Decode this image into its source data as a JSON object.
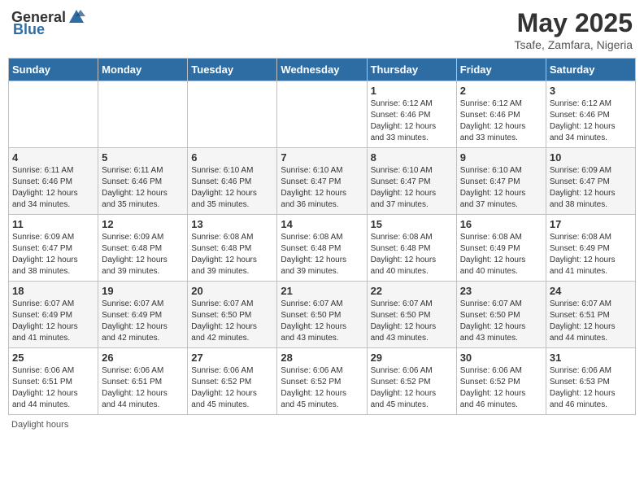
{
  "header": {
    "logo_general": "General",
    "logo_blue": "Blue",
    "month": "May 2025",
    "location": "Tsafe, Zamfara, Nigeria"
  },
  "days_of_week": [
    "Sunday",
    "Monday",
    "Tuesday",
    "Wednesday",
    "Thursday",
    "Friday",
    "Saturday"
  ],
  "footer": {
    "daylight_hours": "Daylight hours"
  },
  "weeks": [
    [
      {
        "day": "",
        "info": ""
      },
      {
        "day": "",
        "info": ""
      },
      {
        "day": "",
        "info": ""
      },
      {
        "day": "",
        "info": ""
      },
      {
        "day": "1",
        "info": "Sunrise: 6:12 AM\nSunset: 6:46 PM\nDaylight: 12 hours\nand 33 minutes."
      },
      {
        "day": "2",
        "info": "Sunrise: 6:12 AM\nSunset: 6:46 PM\nDaylight: 12 hours\nand 33 minutes."
      },
      {
        "day": "3",
        "info": "Sunrise: 6:12 AM\nSunset: 6:46 PM\nDaylight: 12 hours\nand 34 minutes."
      }
    ],
    [
      {
        "day": "4",
        "info": "Sunrise: 6:11 AM\nSunset: 6:46 PM\nDaylight: 12 hours\nand 34 minutes."
      },
      {
        "day": "5",
        "info": "Sunrise: 6:11 AM\nSunset: 6:46 PM\nDaylight: 12 hours\nand 35 minutes."
      },
      {
        "day": "6",
        "info": "Sunrise: 6:10 AM\nSunset: 6:46 PM\nDaylight: 12 hours\nand 35 minutes."
      },
      {
        "day": "7",
        "info": "Sunrise: 6:10 AM\nSunset: 6:47 PM\nDaylight: 12 hours\nand 36 minutes."
      },
      {
        "day": "8",
        "info": "Sunrise: 6:10 AM\nSunset: 6:47 PM\nDaylight: 12 hours\nand 37 minutes."
      },
      {
        "day": "9",
        "info": "Sunrise: 6:10 AM\nSunset: 6:47 PM\nDaylight: 12 hours\nand 37 minutes."
      },
      {
        "day": "10",
        "info": "Sunrise: 6:09 AM\nSunset: 6:47 PM\nDaylight: 12 hours\nand 38 minutes."
      }
    ],
    [
      {
        "day": "11",
        "info": "Sunrise: 6:09 AM\nSunset: 6:47 PM\nDaylight: 12 hours\nand 38 minutes."
      },
      {
        "day": "12",
        "info": "Sunrise: 6:09 AM\nSunset: 6:48 PM\nDaylight: 12 hours\nand 39 minutes."
      },
      {
        "day": "13",
        "info": "Sunrise: 6:08 AM\nSunset: 6:48 PM\nDaylight: 12 hours\nand 39 minutes."
      },
      {
        "day": "14",
        "info": "Sunrise: 6:08 AM\nSunset: 6:48 PM\nDaylight: 12 hours\nand 39 minutes."
      },
      {
        "day": "15",
        "info": "Sunrise: 6:08 AM\nSunset: 6:48 PM\nDaylight: 12 hours\nand 40 minutes."
      },
      {
        "day": "16",
        "info": "Sunrise: 6:08 AM\nSunset: 6:49 PM\nDaylight: 12 hours\nand 40 minutes."
      },
      {
        "day": "17",
        "info": "Sunrise: 6:08 AM\nSunset: 6:49 PM\nDaylight: 12 hours\nand 41 minutes."
      }
    ],
    [
      {
        "day": "18",
        "info": "Sunrise: 6:07 AM\nSunset: 6:49 PM\nDaylight: 12 hours\nand 41 minutes."
      },
      {
        "day": "19",
        "info": "Sunrise: 6:07 AM\nSunset: 6:49 PM\nDaylight: 12 hours\nand 42 minutes."
      },
      {
        "day": "20",
        "info": "Sunrise: 6:07 AM\nSunset: 6:50 PM\nDaylight: 12 hours\nand 42 minutes."
      },
      {
        "day": "21",
        "info": "Sunrise: 6:07 AM\nSunset: 6:50 PM\nDaylight: 12 hours\nand 43 minutes."
      },
      {
        "day": "22",
        "info": "Sunrise: 6:07 AM\nSunset: 6:50 PM\nDaylight: 12 hours\nand 43 minutes."
      },
      {
        "day": "23",
        "info": "Sunrise: 6:07 AM\nSunset: 6:50 PM\nDaylight: 12 hours\nand 43 minutes."
      },
      {
        "day": "24",
        "info": "Sunrise: 6:07 AM\nSunset: 6:51 PM\nDaylight: 12 hours\nand 44 minutes."
      }
    ],
    [
      {
        "day": "25",
        "info": "Sunrise: 6:06 AM\nSunset: 6:51 PM\nDaylight: 12 hours\nand 44 minutes."
      },
      {
        "day": "26",
        "info": "Sunrise: 6:06 AM\nSunset: 6:51 PM\nDaylight: 12 hours\nand 44 minutes."
      },
      {
        "day": "27",
        "info": "Sunrise: 6:06 AM\nSunset: 6:52 PM\nDaylight: 12 hours\nand 45 minutes."
      },
      {
        "day": "28",
        "info": "Sunrise: 6:06 AM\nSunset: 6:52 PM\nDaylight: 12 hours\nand 45 minutes."
      },
      {
        "day": "29",
        "info": "Sunrise: 6:06 AM\nSunset: 6:52 PM\nDaylight: 12 hours\nand 45 minutes."
      },
      {
        "day": "30",
        "info": "Sunrise: 6:06 AM\nSunset: 6:52 PM\nDaylight: 12 hours\nand 46 minutes."
      },
      {
        "day": "31",
        "info": "Sunrise: 6:06 AM\nSunset: 6:53 PM\nDaylight: 12 hours\nand 46 minutes."
      }
    ]
  ]
}
